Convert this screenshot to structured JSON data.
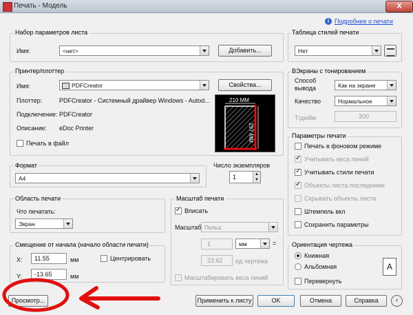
{
  "window": {
    "title": "Печать - Модель",
    "close": "X"
  },
  "help_link": "Подробнее о печати",
  "page_setup": {
    "group": "Набор параметров листа",
    "name_label": "Имя:",
    "name_value": "<нет>",
    "add_button": "Добавить..."
  },
  "printer": {
    "group": "Принтер/плоттер",
    "name_label": "Имя:",
    "name_value": "PDFCreator",
    "properties_button": "Свойства...",
    "plotter_label": "Плоттер:",
    "plotter_value": "PDFCreator - Системный драйвер Windows - Autod...",
    "connection_label": "Подключение:",
    "connection_value": "PDFCreator",
    "description_label": "Описание:",
    "description_value": "eDoc Printer",
    "print_to_file": "Печать в файл",
    "preview_width": "210 MM",
    "preview_height": "297 MM"
  },
  "format": {
    "group": "Формат",
    "value": "A4"
  },
  "copies": {
    "label": "Число экземпляров",
    "value": "1"
  },
  "area": {
    "group": "Область печати",
    "what_label": "Что печатать:",
    "what_value": "Экран"
  },
  "offset": {
    "group": "Смещение от начала (начало области печати)",
    "x_label": "X:",
    "x_value": "11.55",
    "x_unit": "мм",
    "center": "Центрировать",
    "y_label": "Y:",
    "y_value": "-13.65",
    "y_unit": "мм"
  },
  "scale": {
    "group": "Масштаб печати",
    "fit": "Вписать",
    "scale_label": "Масштаб:",
    "scale_value": "Польз.",
    "v1": "1",
    "unit": "мм",
    "equals": "=",
    "v2": "23.62",
    "unit2": "ед.чертежа",
    "scale_weights": "Масштабировать веса линий"
  },
  "style_table": {
    "group": "Таблица стилей печати",
    "value": "Нет"
  },
  "shaded": {
    "group": "ВЭкраны с тонированием",
    "mode_label1": "Способ",
    "mode_label2": "вывода",
    "mode_value": "Как на экране",
    "quality_label": "Качество",
    "quality_value": "Нормальное",
    "dpi_label": "Т/дюйм",
    "dpi_value": "300"
  },
  "options": {
    "group": "Параметры печати",
    "items": [
      {
        "label": "Печать в фоновом режиме",
        "checked": false,
        "disabled": false
      },
      {
        "label": "Учитывать веса линий",
        "checked": true,
        "disabled": true
      },
      {
        "label": "Учитывать стили печати",
        "checked": true,
        "disabled": false
      },
      {
        "label": "Объекты листа последними",
        "checked": true,
        "disabled": true
      },
      {
        "label": "Скрывать объекты листа",
        "checked": false,
        "disabled": true
      },
      {
        "label": "Штемпель вкл",
        "checked": false,
        "disabled": false
      },
      {
        "label": "Сохранить параметры",
        "checked": false,
        "disabled": false
      }
    ]
  },
  "orientation": {
    "group": "Ориентация чертежа",
    "portrait": "Книжная",
    "landscape": "Альбомная",
    "flip": "Перевернуть",
    "icon_letter": "A"
  },
  "buttons": {
    "preview": "Просмотр...",
    "apply": "Применить к листу",
    "ok": "OK",
    "cancel": "Отмена",
    "help": "Справка"
  },
  "colors": {
    "annotation": "#e01010"
  }
}
